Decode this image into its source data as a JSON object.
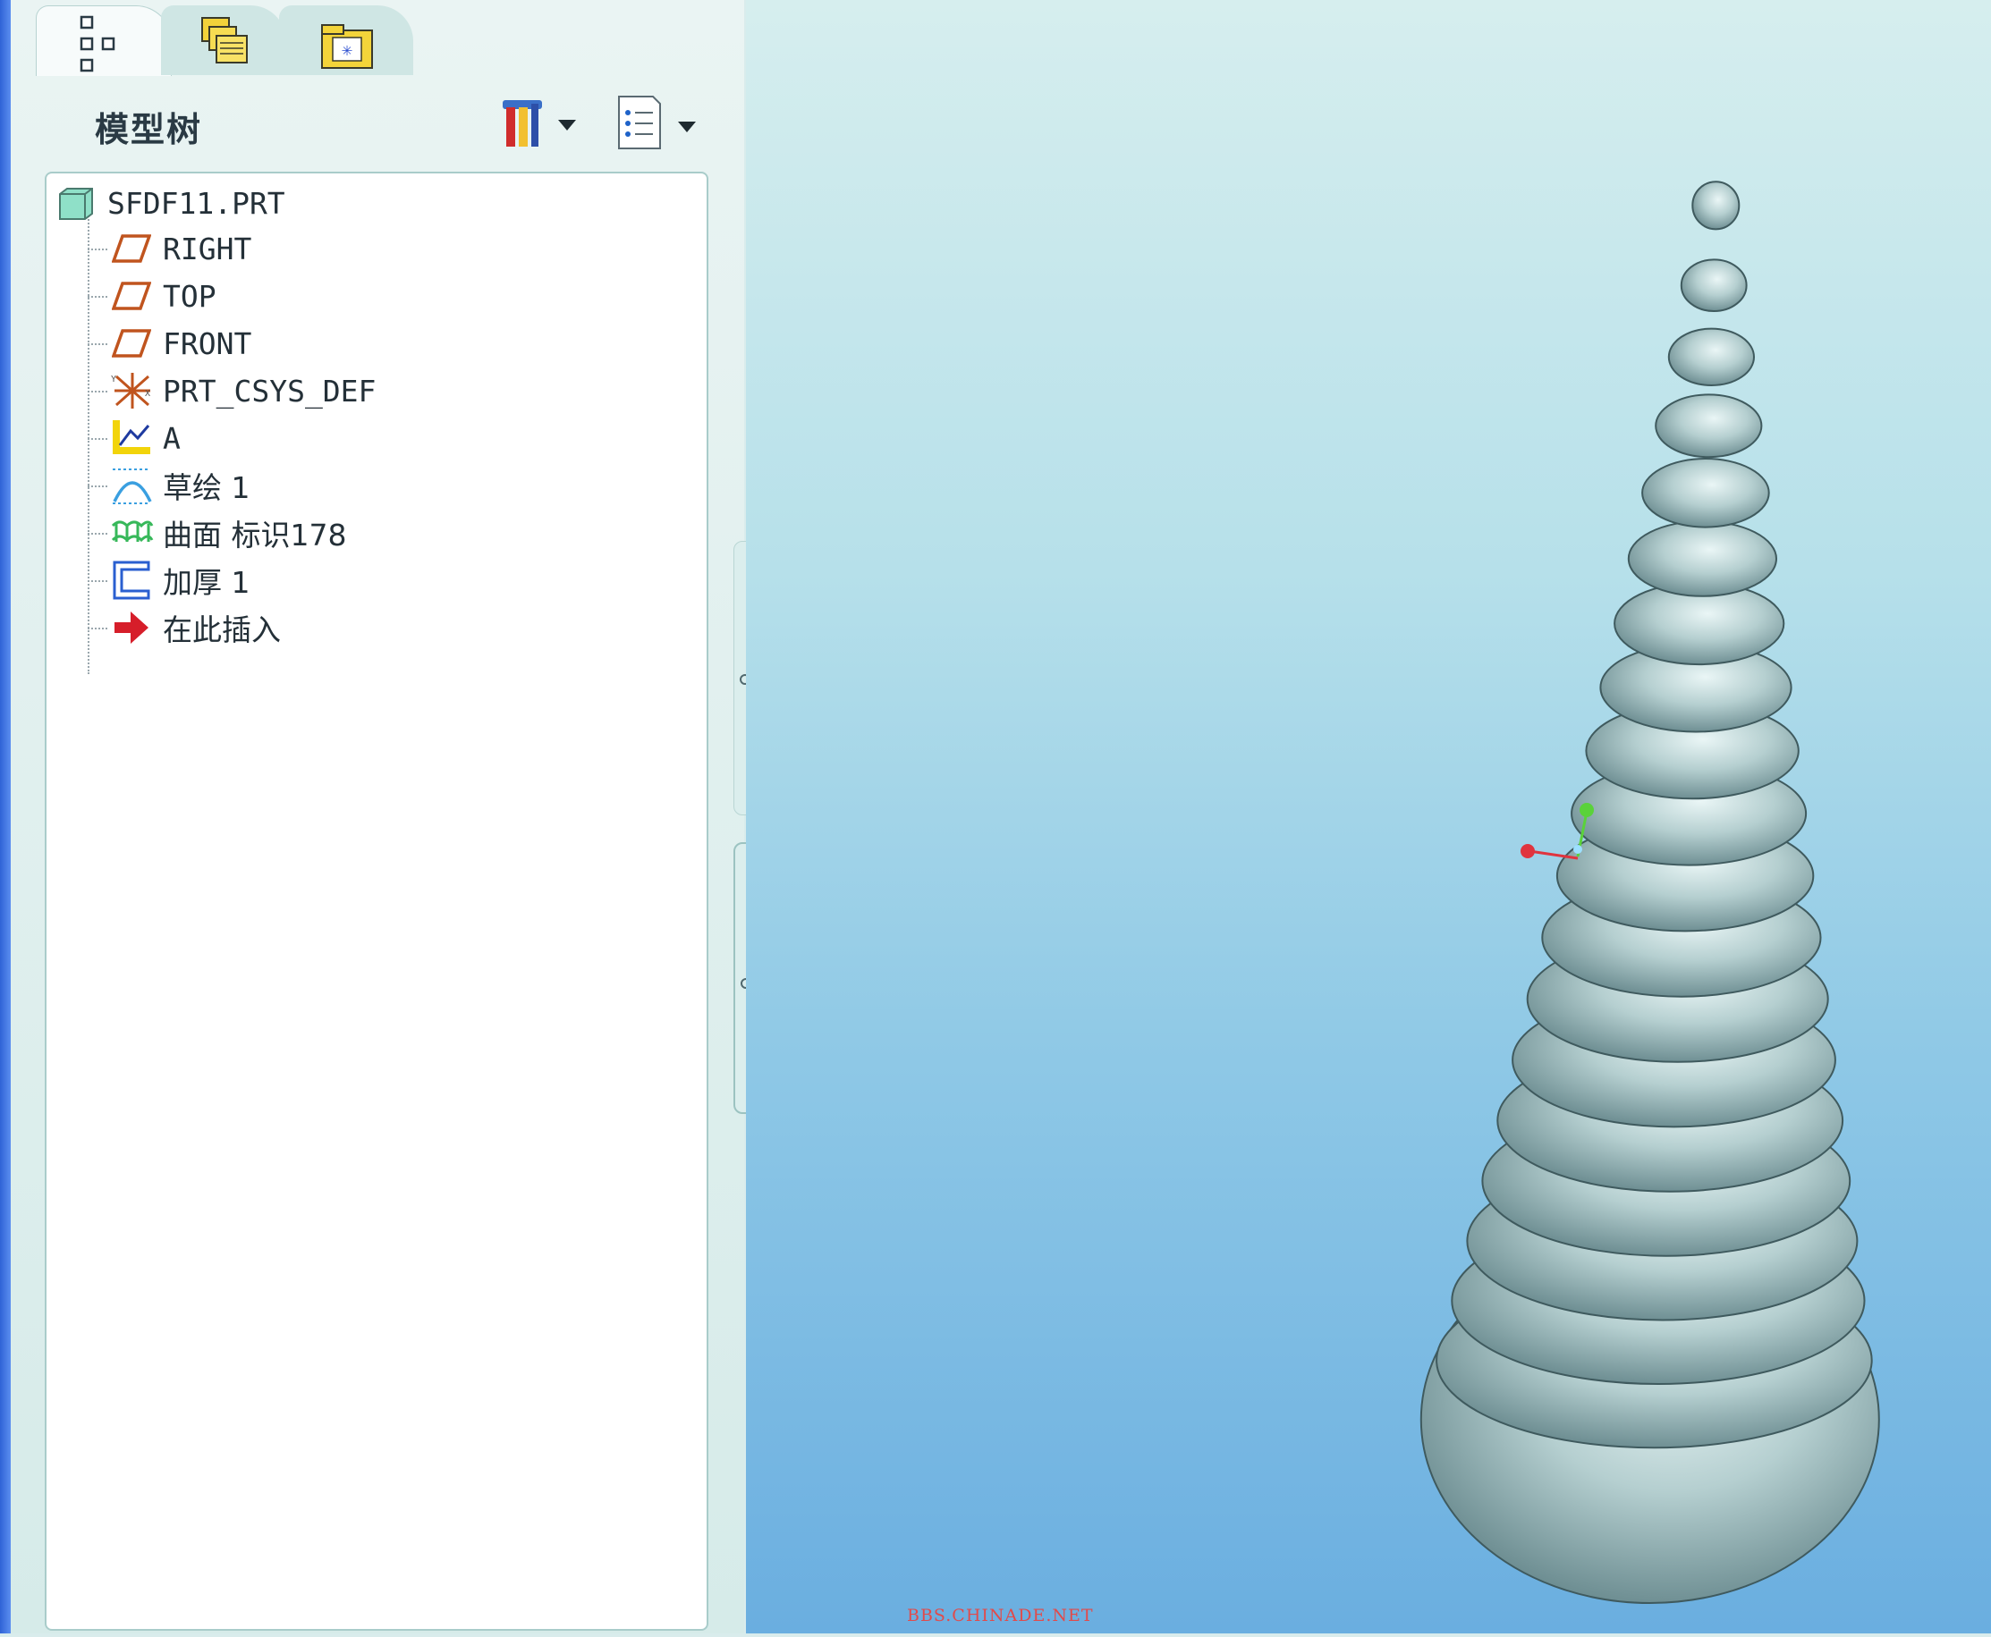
{
  "navigator": {
    "tabs": [
      {
        "name": "model-tree-tab",
        "icon": "tree-structure-icon",
        "active": true
      },
      {
        "name": "folder-browser-tab",
        "icon": "folders-icon",
        "active": false
      },
      {
        "name": "favorites-tab",
        "icon": "favorites-folder-icon",
        "active": false
      }
    ]
  },
  "model_tree": {
    "title": "模型树",
    "tools": [
      {
        "name": "settings-tools-icon"
      },
      {
        "name": "show-list-icon"
      }
    ],
    "root": {
      "label": "SFDF11.PRT",
      "icon": "part-icon"
    },
    "items": [
      {
        "label": "RIGHT",
        "icon": "datum-plane-icon"
      },
      {
        "label": "TOP",
        "icon": "datum-plane-icon"
      },
      {
        "label": "FRONT",
        "icon": "datum-plane-icon"
      },
      {
        "label": "PRT_CSYS_DEF",
        "icon": "coordinate-system-icon"
      },
      {
        "label": "A",
        "icon": "graph-icon"
      },
      {
        "label": "草绘 1",
        "icon": "sketch-icon"
      },
      {
        "label": "曲面 标识178",
        "icon": "surface-icon"
      },
      {
        "label": "加厚 1",
        "icon": "thicken-icon"
      },
      {
        "label": "在此插入",
        "icon": "insert-here-arrow-icon"
      }
    ]
  },
  "viewport": {
    "model": "spiral-shell-3d-model",
    "background_top": "#d6eeee",
    "background_bottom": "#6aaee0",
    "shell_color": "#a9c6c6",
    "watermark": "BBS.CHINADE.NET"
  }
}
